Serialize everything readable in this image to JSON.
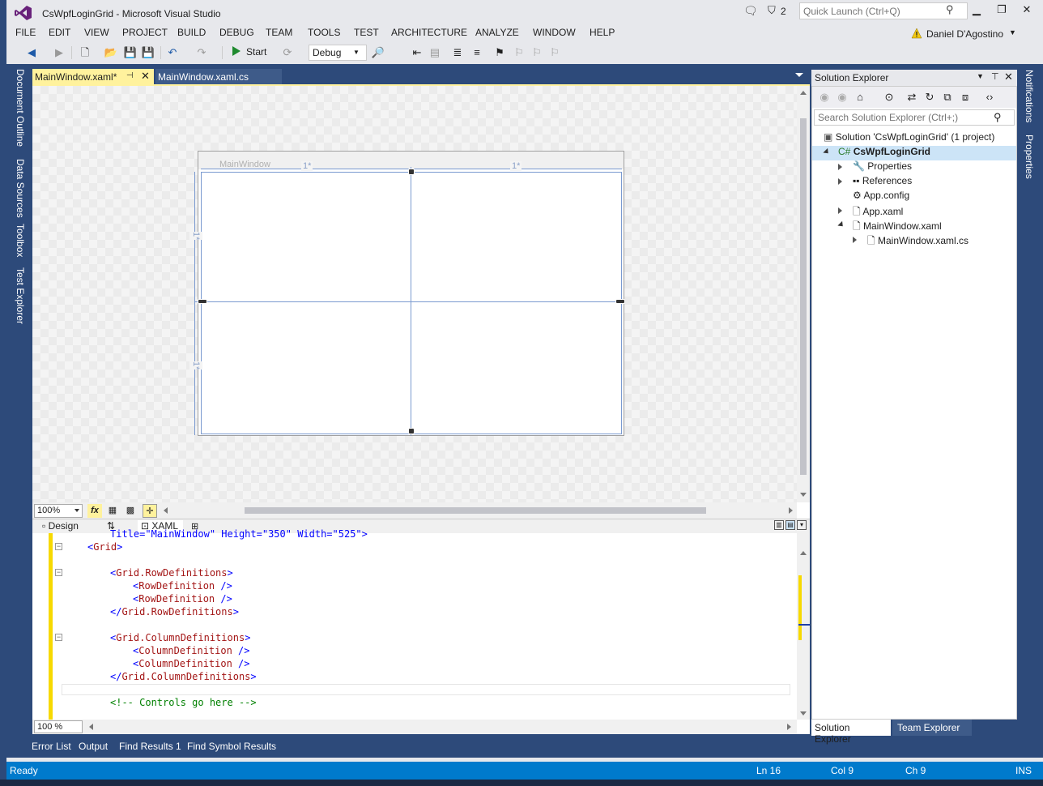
{
  "window": {
    "title": "CsWpfLoginGrid - Microsoft Visual Studio",
    "notification_count": "2",
    "quick_launch_placeholder": "Quick Launch (Ctrl+Q)",
    "min_glyph": "▁",
    "restore_glyph": "❐",
    "close_glyph": "✕"
  },
  "menu": [
    "FILE",
    "EDIT",
    "VIEW",
    "PROJECT",
    "BUILD",
    "DEBUG",
    "TEAM",
    "TOOLS",
    "TEST",
    "ARCHITECTURE",
    "ANALYZE",
    "WINDOW",
    "HELP"
  ],
  "user": {
    "name": "Daniel D'Agostino"
  },
  "toolbar": {
    "start_label": "Start",
    "configuration": "Debug",
    "icons": [
      "back-icon",
      "forward-icon",
      "new-project-icon",
      "open-file-icon",
      "save-icon",
      "save-all-icon",
      "undo-icon",
      "redo-icon",
      "start-icon",
      "attach-icon",
      "find-in-files-icon",
      "comment-icon",
      "bookmark-icon"
    ]
  },
  "left_tool_tabs": [
    "Document Outline",
    "Data Sources",
    "Toolbox",
    "Test Explorer"
  ],
  "right_tool_tabs": [
    "Notifications",
    "Properties"
  ],
  "doc_tabs": {
    "active": "MainWindow.xaml*",
    "inactive": "MainWindow.xaml.cs"
  },
  "designer": {
    "window_caption": "MainWindow",
    "column_star_1": "1*",
    "column_star_2": "1*",
    "row_star_1": "1*",
    "row_star_2": "1*",
    "zoom": "100%",
    "fx_label": "fx"
  },
  "split_tabs": {
    "design": "Design",
    "swap": "⇅",
    "xaml": "XAML"
  },
  "code": {
    "zoom": "100 %",
    "lines": {
      "l0": "Title=\"MainWindow\" Height=\"350\" Width=\"525\">",
      "l1_open": "<",
      "l1_tag": "Grid",
      "l1_close": ">",
      "l2_open": "<",
      "l2_tag": "Grid.RowDefinitions",
      "l2_close": ">",
      "l3_open": "<",
      "l3_tag": "RowDefinition",
      "l3_close": " />",
      "l4_open": "<",
      "l4_tag": "RowDefinition",
      "l4_close": " />",
      "l5_open": "</",
      "l5_tag": "Grid.RowDefinitions",
      "l5_close": ">",
      "l6_open": "<",
      "l6_tag": "Grid.ColumnDefinitions",
      "l6_close": ">",
      "l7_open": "<",
      "l7_tag": "ColumnDefinition",
      "l7_close": " />",
      "l8_open": "<",
      "l8_tag": "ColumnDefinition",
      "l8_close": " />",
      "l9_open": "</",
      "l9_tag": "Grid.ColumnDefinitions",
      "l9_close": ">",
      "l10_comment": "<!-- Controls go here -->"
    }
  },
  "solution_explorer": {
    "title": "Solution Explorer",
    "search_placeholder": "Search Solution Explorer (Ctrl+;)",
    "solution": "Solution 'CsWpfLoginGrid' (1 project)",
    "project": "CsWpfLoginGrid",
    "items": [
      "Properties",
      "References",
      "App.config",
      "App.xaml",
      "MainWindow.xaml",
      "MainWindow.xaml.cs"
    ],
    "tab_active": "Solution Explorer",
    "tab_inactive": "Team Explorer"
  },
  "bottom_tabs": [
    "Error List",
    "Output",
    "Find Results 1",
    "Find Symbol Results"
  ],
  "status": {
    "state": "Ready",
    "line": "Ln 16",
    "col": "Col 9",
    "ch": "Ch 9",
    "mode": "INS"
  },
  "colors": {
    "accent": "#007acc",
    "active_tab": "#fff29d",
    "dark_chrome": "#2d4a7a",
    "inactive_tab": "#3e5b89",
    "tag": "#a31515",
    "punctuation": "#0000ff",
    "comment": "#008000"
  }
}
